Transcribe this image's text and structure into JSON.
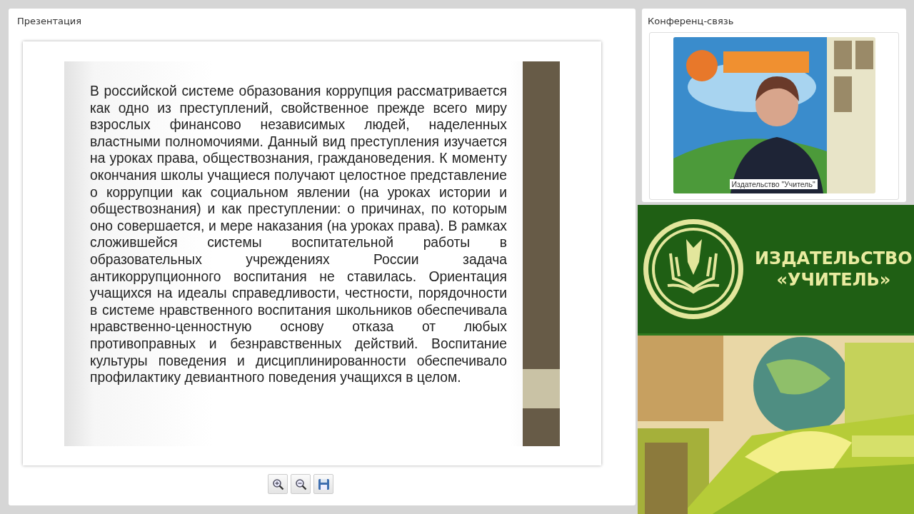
{
  "presentation": {
    "title": "Презентация",
    "slide": {
      "text": "В российской системе образования коррупция рассматривается как одно из преступлений, свойственное прежде всего миру взрослых финансово независимых людей, наделенных властными полномочиями. Данный вид преступления изучается на уроках права, обществознания, граждановедения. К моменту окончания школы учащиеся получают целостное представление о коррупции как социальном явлении (на уроках истории и обществознания) и как преступлении: о причинах, по которым оно совершается, и мере наказания (на уроках права). В рамках сложившейся системы воспитательной работы в образовательных учреждениях России задача антикоррупционного воспитания не ставилась. Ориентация учащихся на идеалы справедливости, честности, порядочности в системе нравственного воспитания школьников обеспечивала нравственно-ценностную основу отказа от любых противоправных и безнравственных действий. Воспитание культуры поведения и дисциплинированности обеспечивало профилактику девиантного поведения учащихся в целом."
    },
    "toolbar": [
      {
        "kind": "zoom-in"
      },
      {
        "kind": "zoom-out"
      },
      {
        "kind": "save"
      }
    ]
  },
  "conference": {
    "title": "Конференц-связь",
    "video": {
      "kind": "picture",
      "caption": "Издательство \"Учитель\""
    }
  },
  "banner": {
    "line_1": "ИЗДАТЕЛЬСТВО",
    "line_2": "«УЧИТЕЛЬ»"
  }
}
